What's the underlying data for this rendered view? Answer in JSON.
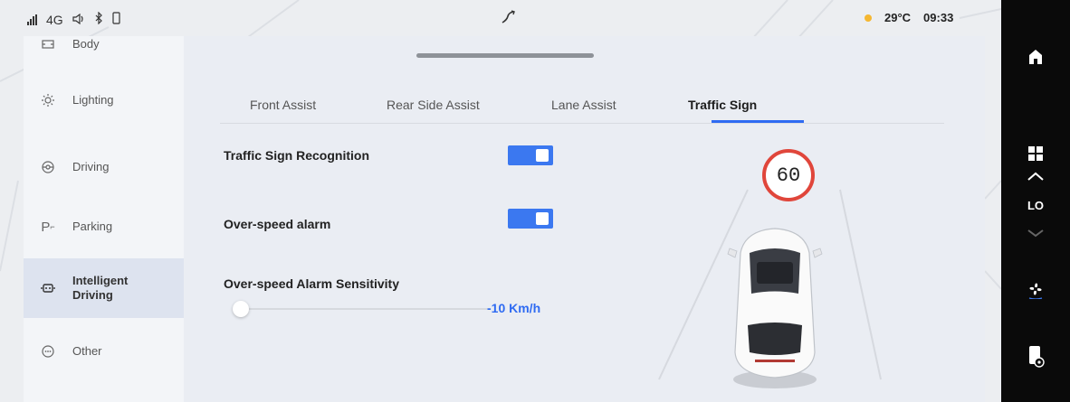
{
  "status_bar": {
    "network": "4G",
    "temperature": "29°C",
    "time": "09:33"
  },
  "sidebar": {
    "items": [
      {
        "label": "Body",
        "icon": "body-icon",
        "active": false
      },
      {
        "label": "Lighting",
        "icon": "lighting-icon",
        "active": false
      },
      {
        "label": "Driving",
        "icon": "driving-icon",
        "active": false
      },
      {
        "label": "Parking",
        "icon": "parking-icon",
        "active": false
      },
      {
        "label": "Intelligent Driving",
        "icon": "intelligent-driving-icon",
        "active": true
      },
      {
        "label": "Other",
        "icon": "other-icon",
        "active": false
      }
    ]
  },
  "tabs": [
    {
      "label": "Front Assist",
      "active": false
    },
    {
      "label": "Rear Side Assist",
      "active": false
    },
    {
      "label": "Lane Assist",
      "active": false
    },
    {
      "label": "Traffic Sign",
      "active": true
    }
  ],
  "settings": {
    "traffic_sign_recognition": {
      "label": "Traffic Sign Recognition",
      "enabled": true
    },
    "over_speed_alarm": {
      "label": "Over-speed alarm",
      "enabled": true
    },
    "sensitivity": {
      "label": "Over-speed Alarm Sensitivity",
      "value": "-10 Km/h",
      "level": 0.0
    }
  },
  "illustration": {
    "speed_sign": "60"
  },
  "dock": {
    "climate_label": "LO"
  },
  "colors": {
    "accent": "#2f6bf2",
    "toggle_on": "#3b78f0",
    "sign_border": "#e0463b",
    "dock_bg": "#0a0a0a"
  }
}
